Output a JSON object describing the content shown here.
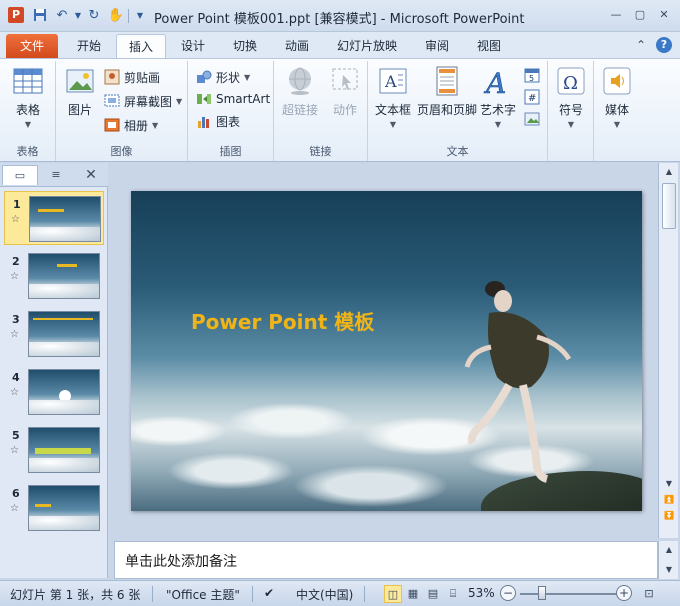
{
  "titlebar": {
    "app_icon": "P",
    "title": "Power Point  模板001.ppt [兼容模式]  -  Microsoft PowerPoint",
    "minimize": "—",
    "maximize": "▢",
    "close": "✕"
  },
  "tabs": {
    "file": "文件",
    "home": "开始",
    "insert": "插入",
    "design": "设计",
    "transitions": "切换",
    "animations": "动画",
    "slideshow": "幻灯片放映",
    "review": "审阅",
    "view": "视图"
  },
  "ribbon": {
    "table": {
      "button": "表格",
      "group": "表格"
    },
    "images": {
      "picture": "图片",
      "clipart": "剪贴画",
      "screenshot": "屏幕截图",
      "album": "相册",
      "group": "图像"
    },
    "illustrations": {
      "shapes": "形状",
      "smartart": "SmartArt",
      "chart": "图表",
      "group": "插图"
    },
    "links": {
      "hyperlink": "超链接",
      "action": "动作",
      "group": "链接"
    },
    "text": {
      "textbox": "文本框",
      "header_footer": "页眉和页脚",
      "wordart": "艺术字",
      "group": "文本"
    },
    "symbols": {
      "button": "符号"
    },
    "media": {
      "button": "媒体"
    }
  },
  "slides": [
    {
      "num": "1",
      "star": "☆"
    },
    {
      "num": "2",
      "star": "☆"
    },
    {
      "num": "3",
      "star": "☆"
    },
    {
      "num": "4",
      "star": "☆"
    },
    {
      "num": "5",
      "star": "☆"
    },
    {
      "num": "6",
      "star": "☆"
    }
  ],
  "current_slide": {
    "title": "Power Point  模板"
  },
  "notes": {
    "placeholder": "单击此处添加备注"
  },
  "statusbar": {
    "slide_info": "幻灯片 第 1 张，共 6 张",
    "theme": "\"Office 主题\"",
    "language": "中文(中国)",
    "zoom": "53%"
  },
  "zoom_level": 0.53,
  "colors": {
    "file_tab": "#d24a1c",
    "slide_title": "#f0b417",
    "selected_slide": "#fde99a"
  }
}
